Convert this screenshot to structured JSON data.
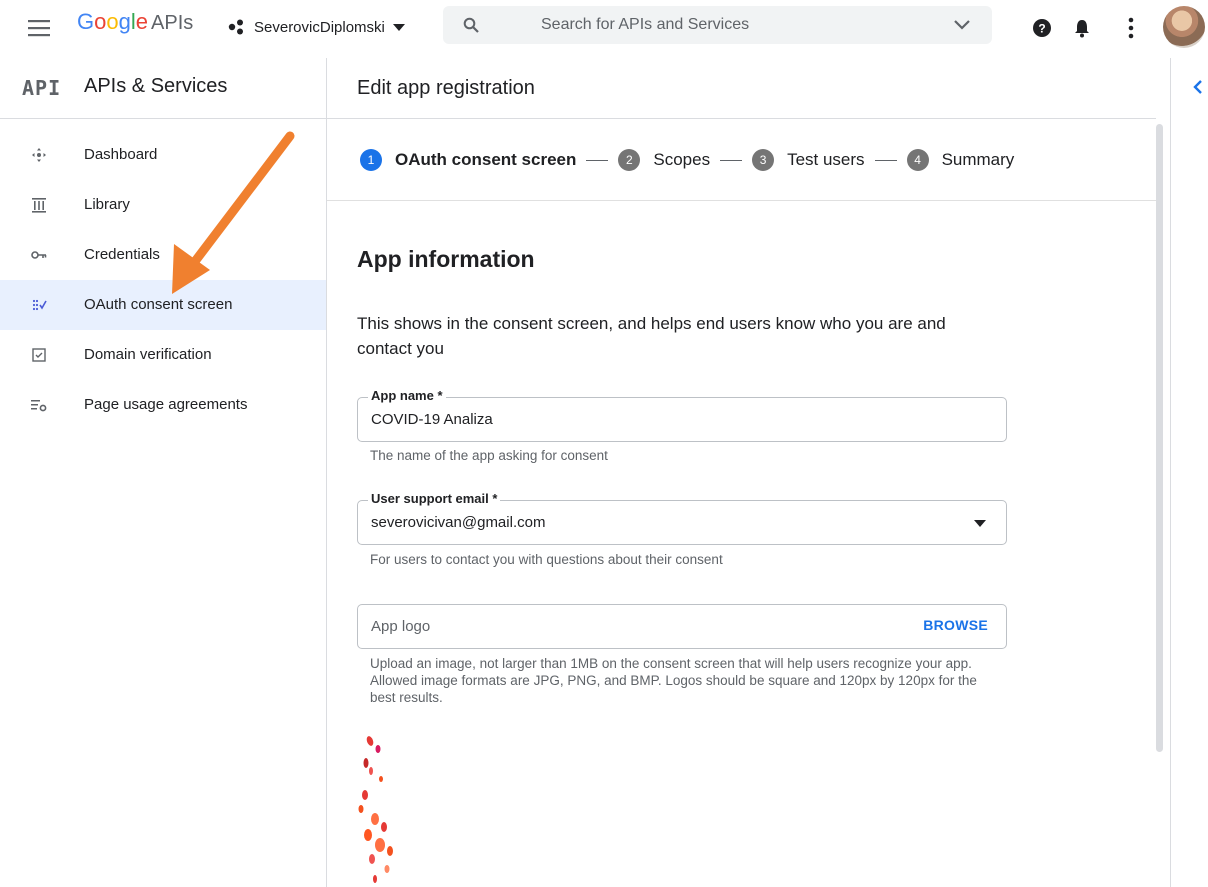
{
  "header": {
    "logo_letters": [
      "G",
      "o",
      "o",
      "g",
      "l",
      "e"
    ],
    "logo_suffix": "APIs",
    "project_name": "SeverovicDiplomski",
    "search_placeholder": "Search for APIs and Services"
  },
  "sidebar": {
    "badge": "API",
    "title": "APIs & Services",
    "items": [
      {
        "label": "Dashboard",
        "icon": "dashboard-icon"
      },
      {
        "label": "Library",
        "icon": "library-icon"
      },
      {
        "label": "Credentials",
        "icon": "key-icon"
      },
      {
        "label": "OAuth consent screen",
        "icon": "consent-icon",
        "active": true
      },
      {
        "label": "Domain verification",
        "icon": "checkbox-icon"
      },
      {
        "label": "Page usage agreements",
        "icon": "settings-list-icon"
      }
    ]
  },
  "main": {
    "title": "Edit app registration",
    "steps": [
      {
        "num": "1",
        "label": "OAuth consent screen",
        "active": true
      },
      {
        "num": "2",
        "label": "Scopes"
      },
      {
        "num": "3",
        "label": "Test users"
      },
      {
        "num": "4",
        "label": "Summary"
      }
    ],
    "section_title": "App information",
    "intro": "This shows in the consent screen, and helps end users know who you are and contact you",
    "app_name": {
      "label": "App name *",
      "value": "COVID-19 Analiza",
      "help": "The name of the app asking for consent"
    },
    "support_email": {
      "label": "User support email *",
      "value": "severovicivan@gmail.com",
      "help": "For users to contact you with questions about their consent"
    },
    "app_logo": {
      "placeholder": "App logo",
      "button": "BROWSE",
      "help": "Upload an image, not larger than 1MB on the consent screen that will help users recognize your app. Allowed image formats are JPG, PNG, and BMP. Logos should be square and 120px by 120px for the best results."
    }
  },
  "colors": {
    "accent": "#1a73e8",
    "active_nav_bg": "#e8f0fe",
    "annotation_arrow": "#f0802f"
  }
}
